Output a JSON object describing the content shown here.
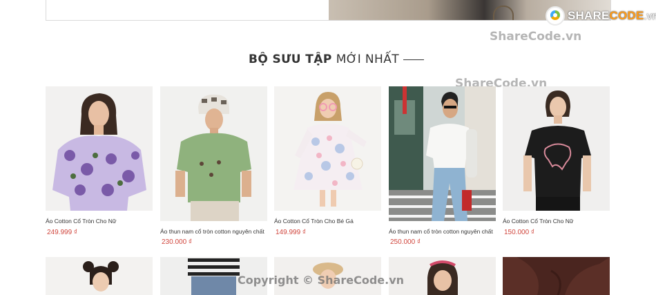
{
  "brand": {
    "logo_main": "SHARE",
    "logo_accent": "CODE",
    "logo_domain": ".vn"
  },
  "watermarks": [
    "ShareCode.vn",
    "ShareCode.vn",
    "Copyright © ShareCode.vn"
  ],
  "section": {
    "title_strong": "BỘ SƯU TẬP",
    "title_light": "MỚI NHẤT"
  },
  "products": [
    {
      "name": "Áo Cotton Cổ Tròn Cho Nữ",
      "price": "249.999 ₫"
    },
    {
      "name": "Áo thun nam cổ tròn cotton nguyên chất",
      "price": "230.000 ₫"
    },
    {
      "name": "Áo Cotton Cổ Tròn Cho Bé Gá",
      "price": "149.999 ₫"
    },
    {
      "name": "Áo thun nam cổ tròn cotton nguyên chất",
      "price": "250.000 ₫"
    },
    {
      "name": "Áo Cotton Cổ Tròn Cho Nữ",
      "price": "150.000 ₫"
    }
  ],
  "colors": {
    "price": "#d0453c",
    "logo_accent": "#ff9c1a"
  }
}
